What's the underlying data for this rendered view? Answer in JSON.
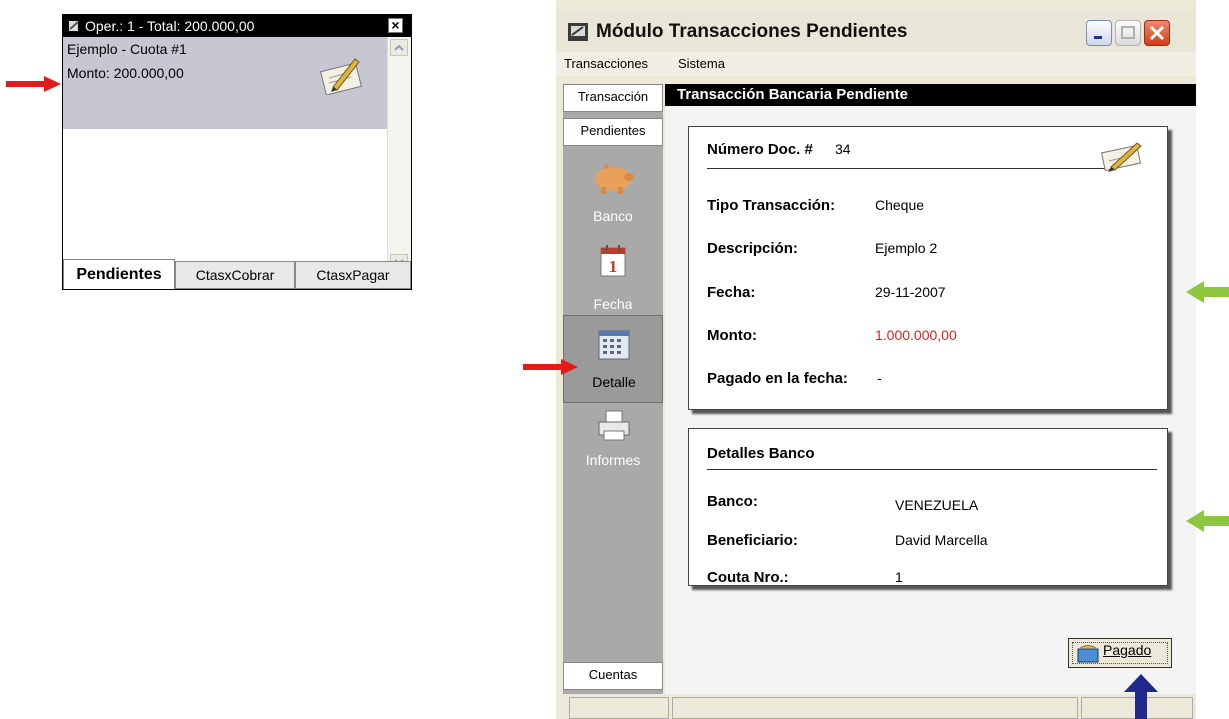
{
  "widget": {
    "title": "Oper.: 1 - Total: 200.000,00",
    "close_label": "×",
    "item": {
      "line1": "Ejemplo - Cuota #1",
      "line2": "Monto: 200.000,00"
    },
    "tabs": [
      {
        "label": "Pendientes",
        "active": true
      },
      {
        "label": "CtasxCobrar",
        "active": false
      },
      {
        "label": "CtasxPagar",
        "active": false
      }
    ]
  },
  "window": {
    "title": "Módulo Transacciones Pendientes",
    "menu": [
      "Transacciones",
      "Sistema"
    ],
    "side_tabs": {
      "transaccion": "Transacción",
      "pendientes": "Pendientes",
      "cuentas": "Cuentas"
    },
    "tools": [
      {
        "label": "Banco"
      },
      {
        "label": "Fecha",
        "day": "1"
      },
      {
        "label": "Detalle"
      },
      {
        "label": "Informes"
      }
    ],
    "header": "Transacción Bancaria Pendiente",
    "doc_panel": {
      "title_label": "Número Doc. #",
      "title_value": "34",
      "fields": [
        {
          "label": "Tipo Transacción:",
          "value": "Cheque"
        },
        {
          "label": "Descripción:",
          "value": "Ejemplo 2"
        },
        {
          "label": "Fecha:",
          "value": "29-11-2007"
        },
        {
          "label": "Monto:",
          "value": "1.000.000,00"
        },
        {
          "label": "Pagado en la fecha:",
          "value": "-"
        }
      ]
    },
    "bank_panel": {
      "title": "Detalles Banco",
      "fields": [
        {
          "label": "Banco:",
          "value": "VENEZUELA"
        },
        {
          "label": "Beneficiario:",
          "value": "David Marcella"
        },
        {
          "label": "Couta Nro.:",
          "value": "1"
        }
      ]
    },
    "pagado_button": "Pagado"
  },
  "colors": {
    "arrow_red": "#e31b1b",
    "arrow_green": "#8dc63f",
    "arrow_blue": "#1f2a8a",
    "amount_red": "#e0201c"
  }
}
